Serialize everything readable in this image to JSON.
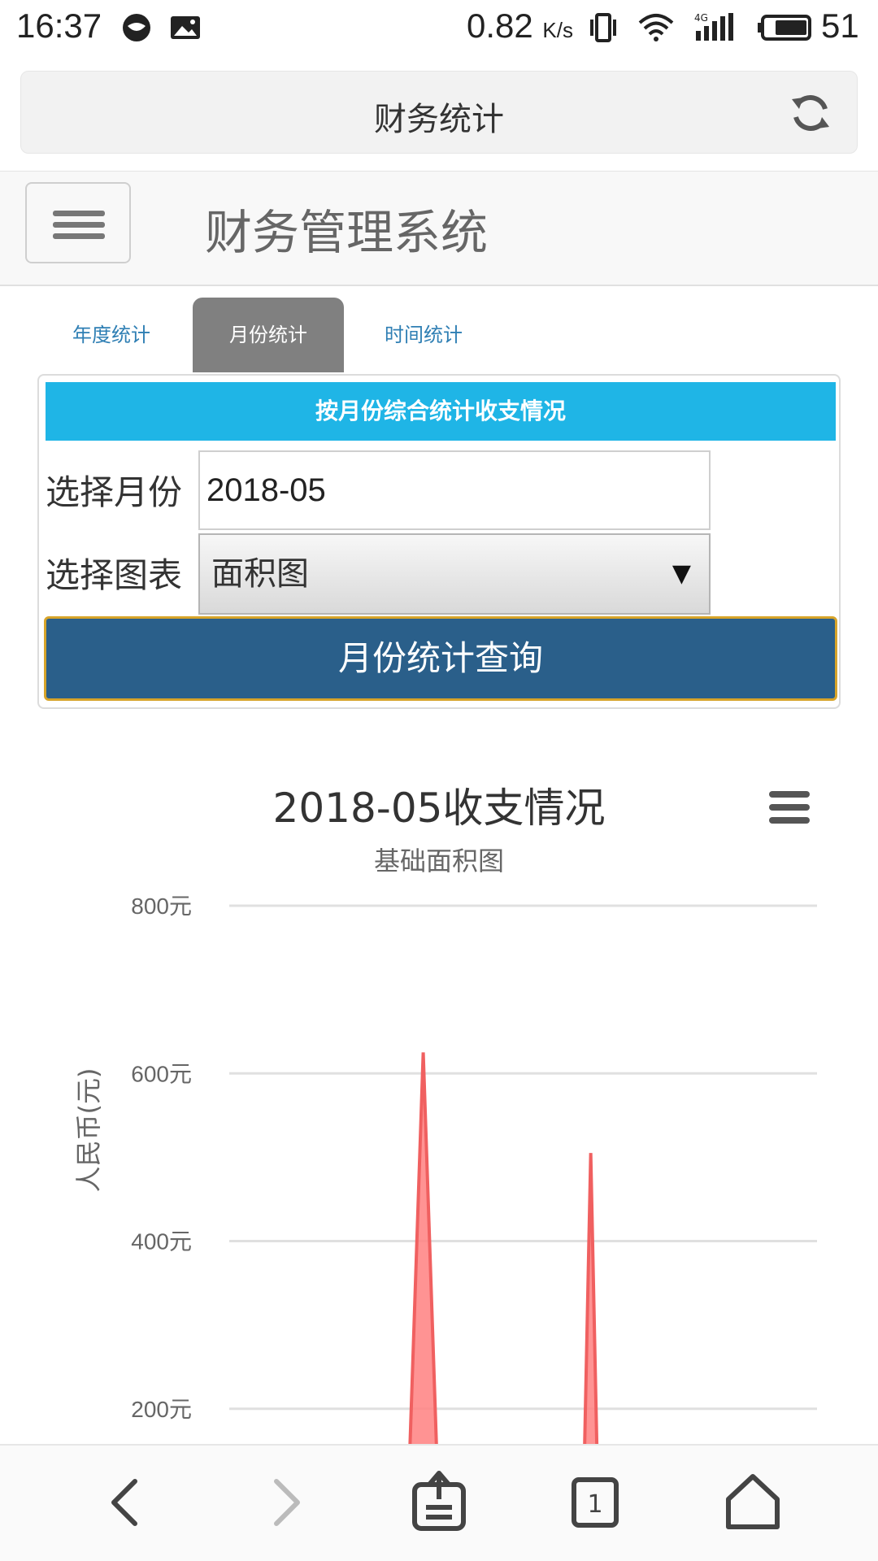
{
  "status_bar": {
    "time": "16:37",
    "net_speed": "0.82",
    "net_unit": "K/s",
    "battery_level": "51",
    "icons": [
      "browser-icon",
      "image-icon",
      "vibrate-icon",
      "wifi-icon",
      "signal-4g-icon",
      "battery-icon"
    ]
  },
  "browser": {
    "page_title": "财务统计"
  },
  "app": {
    "brand": "财务管理系统"
  },
  "tabs": [
    {
      "label": "年度统计",
      "active": false
    },
    {
      "label": "月份统计",
      "active": true
    },
    {
      "label": "时间统计",
      "active": false
    }
  ],
  "form": {
    "header": "按月份综合统计收支情况",
    "month_label": "选择月份",
    "month_value": "2018-05",
    "chart_label": "选择图表",
    "chart_selected": "面积图",
    "submit_label": "月份统计查询"
  },
  "chart_data": {
    "type": "area",
    "title": "2018-05收支情况",
    "subtitle": "基础面积图",
    "ylabel": "人民币(元)",
    "ylim": [
      0,
      800
    ],
    "yticks": [
      "800元",
      "600元",
      "400元",
      "200元"
    ],
    "grid": true,
    "series": [
      {
        "color": "#ff8080",
        "x": [
          0,
          0.3,
          0.33,
          0.36,
          0.5,
          0.6,
          0.615,
          0.63,
          1
        ],
        "values": [
          0,
          0,
          625,
          0,
          0,
          0,
          505,
          0,
          0
        ]
      }
    ]
  },
  "colors": {
    "accent": "#1fb5e6",
    "button": "#2a5f8a",
    "button_border": "#d7a42a",
    "tab_active": "#808080",
    "link": "#2f7fb4",
    "area": "#ff8080"
  }
}
